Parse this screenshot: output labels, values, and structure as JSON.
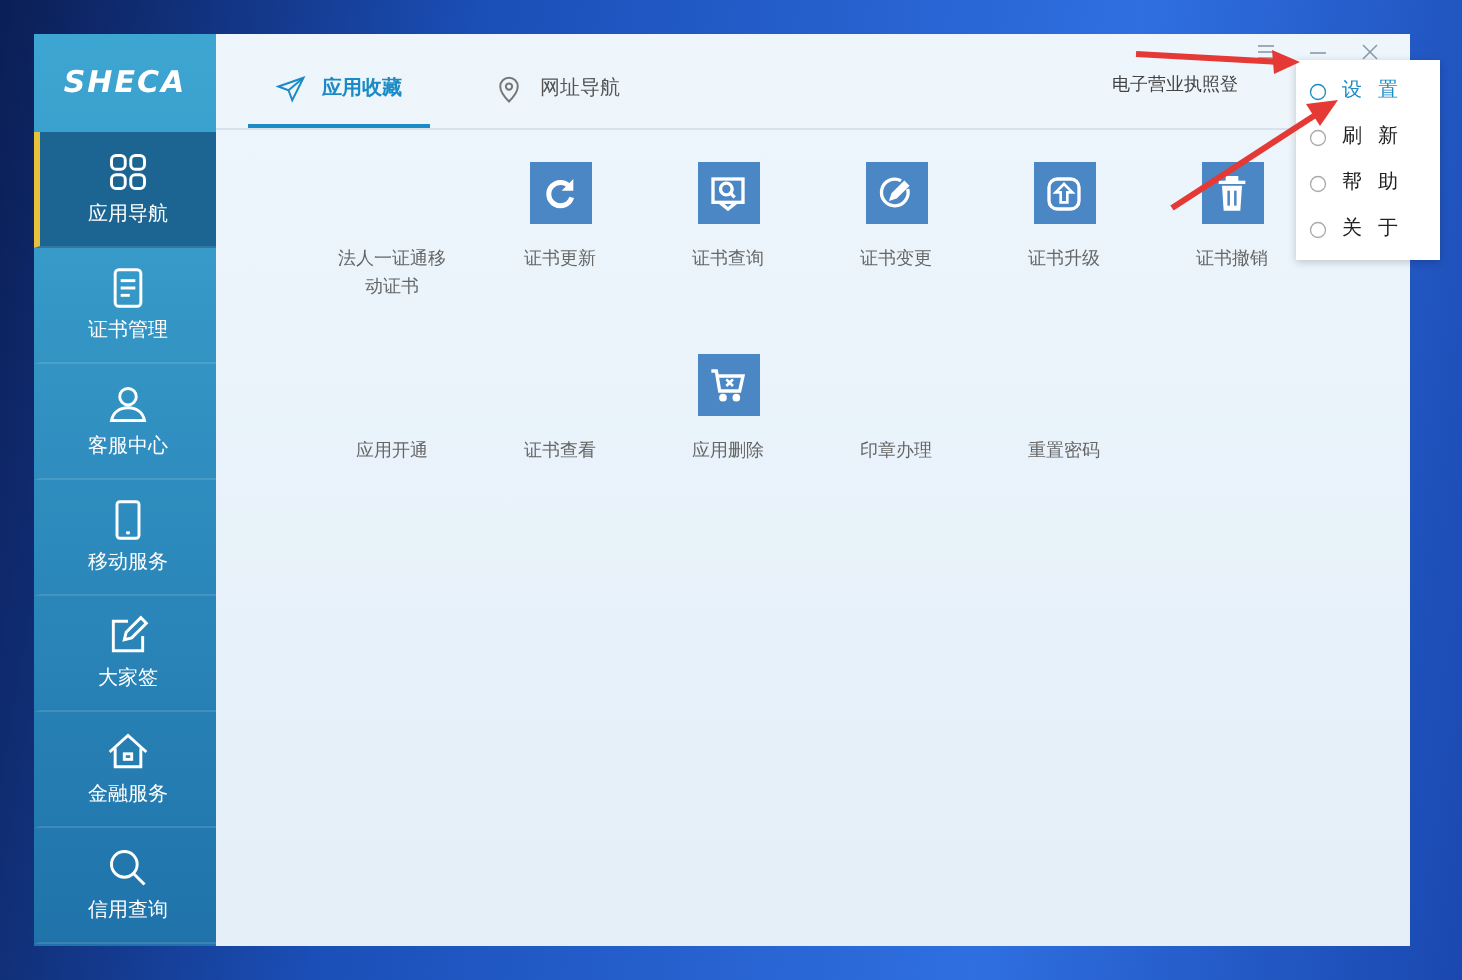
{
  "logo": {
    "text": "SHECA"
  },
  "sidebar": {
    "items": [
      {
        "label": "应用导航",
        "kind": "grid",
        "selected": true
      },
      {
        "label": "证书管理",
        "kind": "document",
        "selected": false
      },
      {
        "label": "客服中心",
        "kind": "person",
        "selected": false
      },
      {
        "label": "移动服务",
        "kind": "phone",
        "selected": false
      },
      {
        "label": "大家签",
        "kind": "pen",
        "selected": false
      },
      {
        "label": "金融服务",
        "kind": "house",
        "selected": false
      },
      {
        "label": "信用查询",
        "kind": "search",
        "selected": false
      }
    ]
  },
  "tabs": [
    {
      "label": "应用收藏",
      "kind": "send",
      "selected": true
    },
    {
      "label": "网址导航",
      "kind": "pin",
      "selected": false
    }
  ],
  "header_link": "电子营业执照登",
  "menu": {
    "items": [
      {
        "label": "设置",
        "selected": true
      },
      {
        "label": "刷新",
        "selected": false
      },
      {
        "label": "帮助",
        "selected": false
      },
      {
        "label": "关于",
        "selected": false
      }
    ]
  },
  "apps": [
    [
      {
        "label": "法人一证通移动证书"
      },
      {
        "label": "证书更新",
        "kind": "refresh"
      },
      {
        "label": "证书查询",
        "kind": "search"
      },
      {
        "label": "证书变更",
        "kind": "edit"
      },
      {
        "label": "证书升级",
        "kind": "upgrade"
      },
      {
        "label": "证书撤销",
        "kind": "trash"
      }
    ],
    [
      {
        "label": "应用开通"
      },
      {
        "label": "证书查看"
      },
      {
        "label": "应用删除",
        "kind": "cart"
      },
      {
        "label": "印章办理"
      },
      {
        "label": "重置密码"
      }
    ]
  ]
}
